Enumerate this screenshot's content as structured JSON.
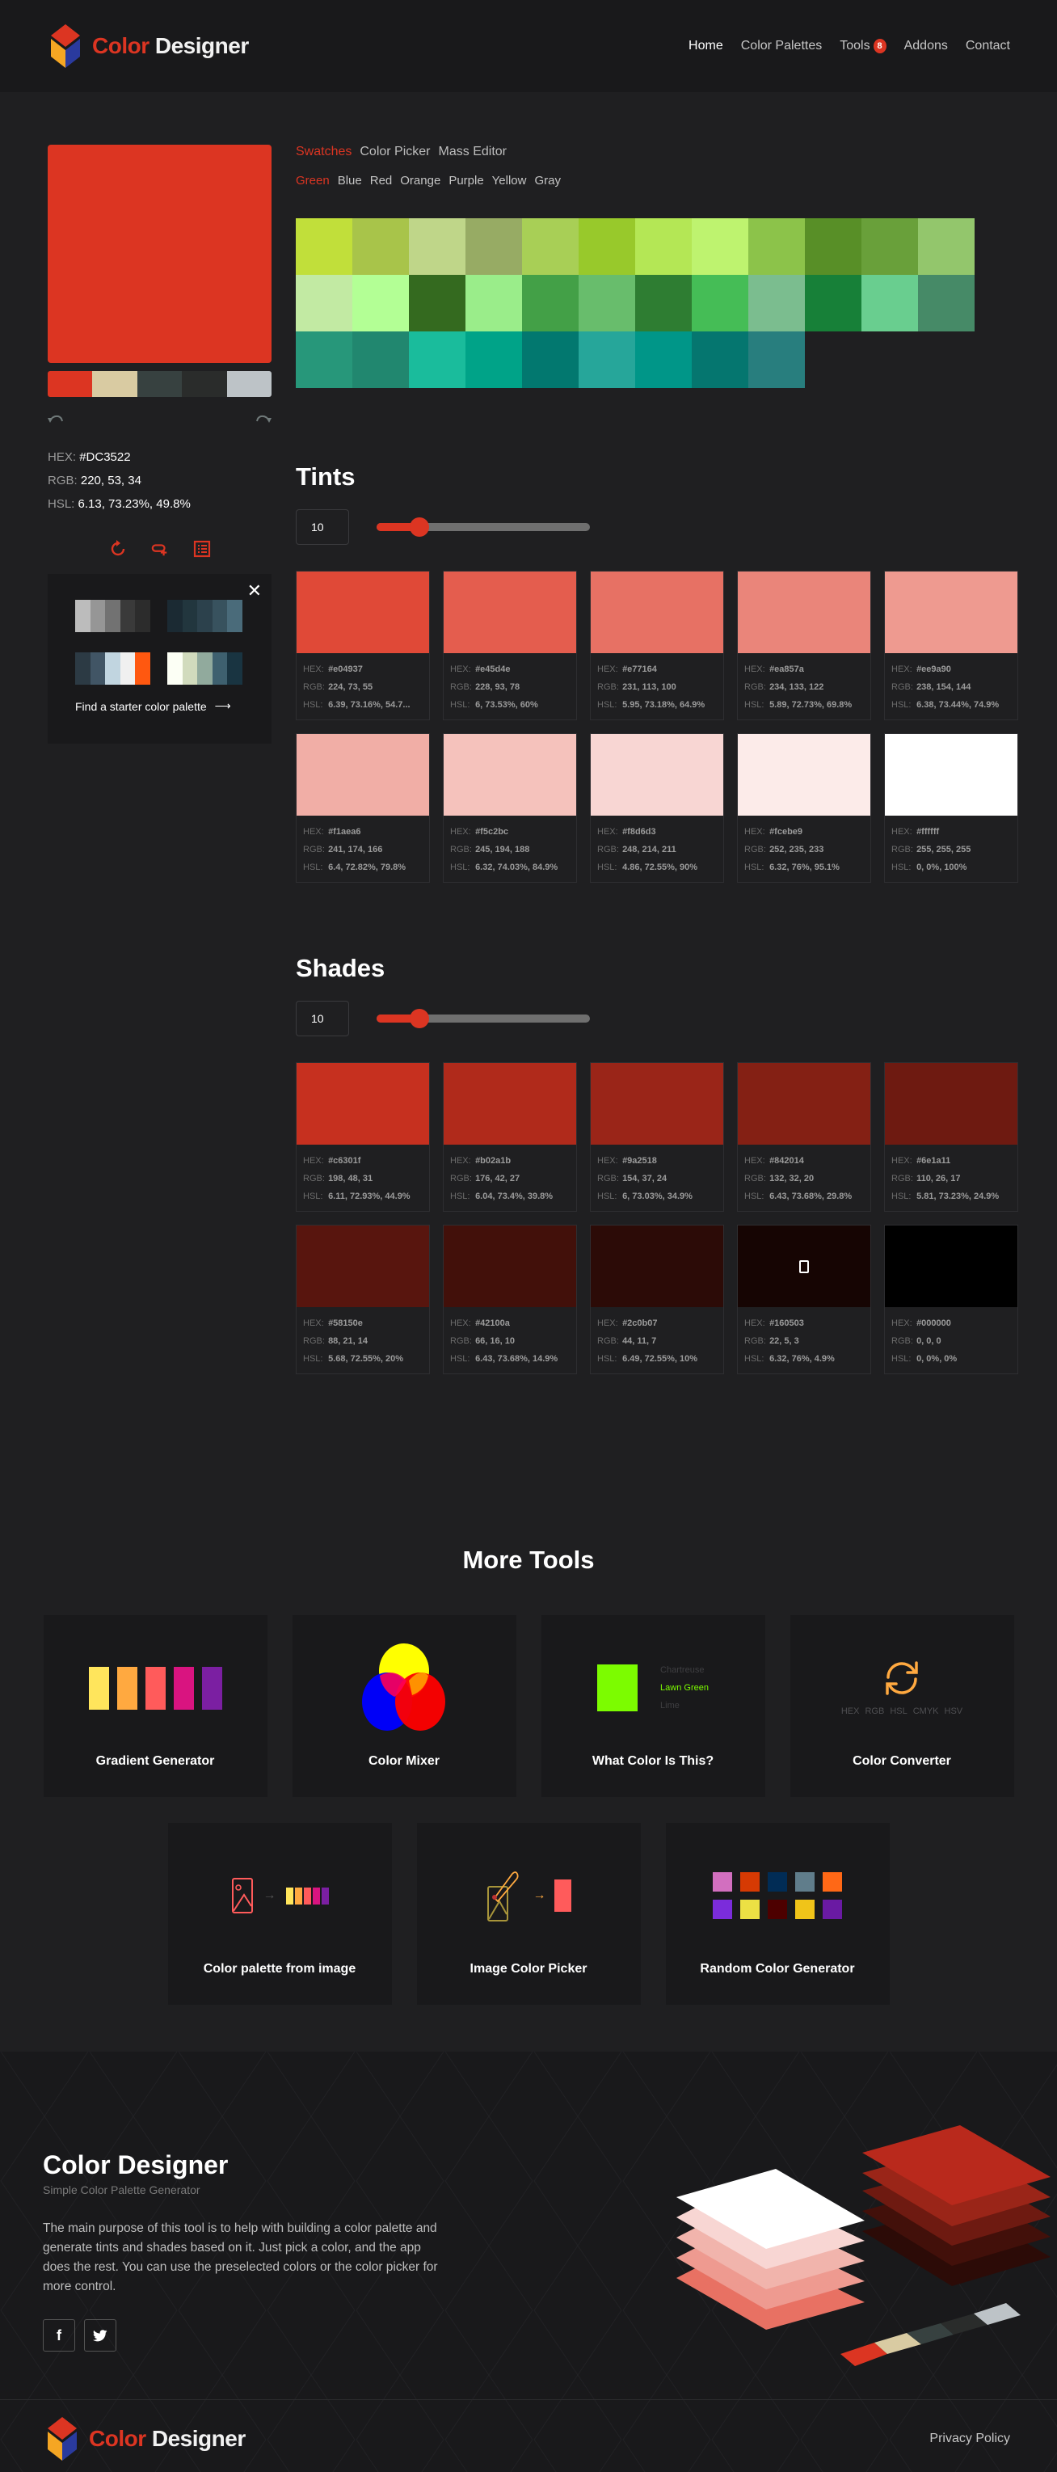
{
  "brand": {
    "part1": "Color",
    "part2": "Designer"
  },
  "nav": {
    "items": [
      {
        "label": "Home",
        "active": true
      },
      {
        "label": "Color Palettes",
        "active": false
      },
      {
        "label": "Tools",
        "active": false,
        "badge": "8"
      },
      {
        "label": "Addons",
        "active": false
      },
      {
        "label": "Contact",
        "active": false
      }
    ]
  },
  "current_color": {
    "hex_label": "HEX:",
    "hex": "#DC3522",
    "rgb_label": "RGB:",
    "rgb": "220, 53, 34",
    "hsl_label": "HSL:",
    "hsl": "6.13, 73.23%, 49.8%",
    "swatch": "#dc3522"
  },
  "palette": [
    "#dc3522",
    "#d9cba2",
    "#374140",
    "#2a2c2b",
    "#bdc3c7"
  ],
  "starter": {
    "find_label": "Find a starter color palette",
    "palettes": [
      [
        "#bcbcbc",
        "#969696",
        "#727272",
        "#3a3a3a",
        "#2c2c2c"
      ],
      [
        "#1b2a33",
        "#22363e",
        "#2c414c",
        "#38525e",
        "#4a6b7a"
      ],
      [
        "#2c3a44",
        "#415565",
        "#c1d5e0",
        "#f0f0f0",
        "#ff5810"
      ],
      [
        "#fcfff5",
        "#d1dbbd",
        "#91aa9d",
        "#3e606f",
        "#193441"
      ]
    ]
  },
  "tabs": [
    {
      "label": "Swatches",
      "active": true
    },
    {
      "label": "Color Picker",
      "active": false
    },
    {
      "label": "Mass Editor",
      "active": false
    }
  ],
  "subtabs": [
    {
      "label": "Green",
      "active": true
    },
    {
      "label": "Blue",
      "active": false
    },
    {
      "label": "Red",
      "active": false
    },
    {
      "label": "Orange",
      "active": false
    },
    {
      "label": "Purple",
      "active": false
    },
    {
      "label": "Yellow",
      "active": false
    },
    {
      "label": "Gray",
      "active": false
    }
  ],
  "swatches": [
    "#c1df3a",
    "#a8c44a",
    "#bfd689",
    "#97ab64",
    "#a8cf56",
    "#98c92b",
    "#b4e755",
    "#bef36f",
    "#8cc34a",
    "#588f27",
    "#69a03a",
    "#93c66c",
    "#c2eaa3",
    "#b3ff95",
    "#346a1f",
    "#9aed8a",
    "#43a047",
    "#68bd6c",
    "#2e7d32",
    "#45bd56",
    "#7bbd8f",
    "#178038",
    "#69ce8f",
    "#468a67",
    "#27977a",
    "#21876f",
    "#1abc9c",
    "#00a388",
    "#02786f",
    "#26a69a",
    "#009688",
    "#05766f",
    "#287e7e"
  ],
  "tints": {
    "title": "Tints",
    "count": "10",
    "slider_fraction": 0.2,
    "items": [
      {
        "hex": "#e04937",
        "rgb": "224, 73, 55",
        "hsl": "6.39, 73.16%, 54.7..."
      },
      {
        "hex": "#e45d4e",
        "rgb": "228, 93, 78",
        "hsl": "6, 73.53%, 60%"
      },
      {
        "hex": "#e77164",
        "rgb": "231, 113, 100",
        "hsl": "5.95, 73.18%, 64.9%"
      },
      {
        "hex": "#ea857a",
        "rgb": "234, 133, 122",
        "hsl": "5.89, 72.73%, 69.8%"
      },
      {
        "hex": "#ee9a90",
        "rgb": "238, 154, 144",
        "hsl": "6.38, 73.44%, 74.9%"
      },
      {
        "hex": "#f1aea6",
        "rgb": "241, 174, 166",
        "hsl": "6.4, 72.82%, 79.8%"
      },
      {
        "hex": "#f5c2bc",
        "rgb": "245, 194, 188",
        "hsl": "6.32, 74.03%, 84.9%"
      },
      {
        "hex": "#f8d6d3",
        "rgb": "248, 214, 211",
        "hsl": "4.86, 72.55%, 90%"
      },
      {
        "hex": "#fcebe9",
        "rgb": "252, 235, 233",
        "hsl": "6.32, 76%, 95.1%"
      },
      {
        "hex": "#ffffff",
        "rgb": "255, 255, 255",
        "hsl": "0, 0%, 100%"
      }
    ]
  },
  "shades": {
    "title": "Shades",
    "count": "10",
    "slider_fraction": 0.2,
    "items": [
      {
        "hex": "#c6301f",
        "rgb": "198, 48, 31",
        "hsl": "6.11, 72.93%, 44.9%"
      },
      {
        "hex": "#b02a1b",
        "rgb": "176, 42, 27",
        "hsl": "6.04, 73.4%, 39.8%"
      },
      {
        "hex": "#9a2518",
        "rgb": "154, 37, 24",
        "hsl": "6, 73.03%, 34.9%"
      },
      {
        "hex": "#842014",
        "rgb": "132, 32, 20",
        "hsl": "6.43, 73.68%, 29.8%"
      },
      {
        "hex": "#6e1a11",
        "rgb": "110, 26, 17",
        "hsl": "5.81, 73.23%, 24.9%"
      },
      {
        "hex": "#58150e",
        "rgb": "88, 21, 14",
        "hsl": "5.68, 72.55%, 20%"
      },
      {
        "hex": "#42100a",
        "rgb": "66, 16, 10",
        "hsl": "6.43, 73.68%, 14.9%"
      },
      {
        "hex": "#2c0b07",
        "rgb": "44, 11, 7",
        "hsl": "6.49, 72.55%, 10%"
      },
      {
        "hex": "#160503",
        "rgb": "22, 5, 3",
        "hsl": "6.32, 76%, 4.9%",
        "icon": "image-icon"
      },
      {
        "hex": "#000000",
        "rgb": "0, 0, 0",
        "hsl": "0, 0%, 0%"
      }
    ]
  },
  "labels": {
    "hex": "HEX:",
    "rgb": "RGB:",
    "hsl": "HSL:"
  },
  "more_tools": {
    "title": "More Tools",
    "tools": [
      {
        "title": "Gradient Generator",
        "colors": [
          "#ffe55c",
          "#ffa940",
          "#ff5b5b",
          "#d91480",
          "#7b1fa2"
        ]
      },
      {
        "title": "Color Mixer"
      },
      {
        "title": "What Color Is This?",
        "swatch": "#7cfc00",
        "names": [
          "Chartreuse",
          "Lawn Green",
          "Lime"
        ],
        "selected": "Lawn Green"
      },
      {
        "title": "Color Converter",
        "formats": [
          "HEX",
          "RGB",
          "HSL",
          "CMYK",
          "HSV"
        ]
      },
      {
        "title": "Color palette from image",
        "colors": [
          "#ffe55c",
          "#ffa940",
          "#ff5b5b",
          "#d91480",
          "#7b1fa2"
        ]
      },
      {
        "title": "Image Color Picker",
        "swatch": "#ff5b5b"
      },
      {
        "title": "Random Color Generator",
        "colors": [
          "#d26fbf",
          "#d63a03",
          "#012c55",
          "#607d8b",
          "#ff6816",
          "#7b2cdb",
          "#ece044",
          "#4d0000",
          "#f0c419",
          "#6a1aa3"
        ]
      }
    ]
  },
  "about": {
    "title": "Color Designer",
    "subtitle": "Simple Color Palette Generator",
    "description": "The main purpose of this tool is to help with building a color palette and generate tints and shades based on it. Just pick a color, and the app does the rest. You can use the preselected colors or the color picker for more control."
  },
  "footer": {
    "privacy": "Privacy Policy"
  }
}
